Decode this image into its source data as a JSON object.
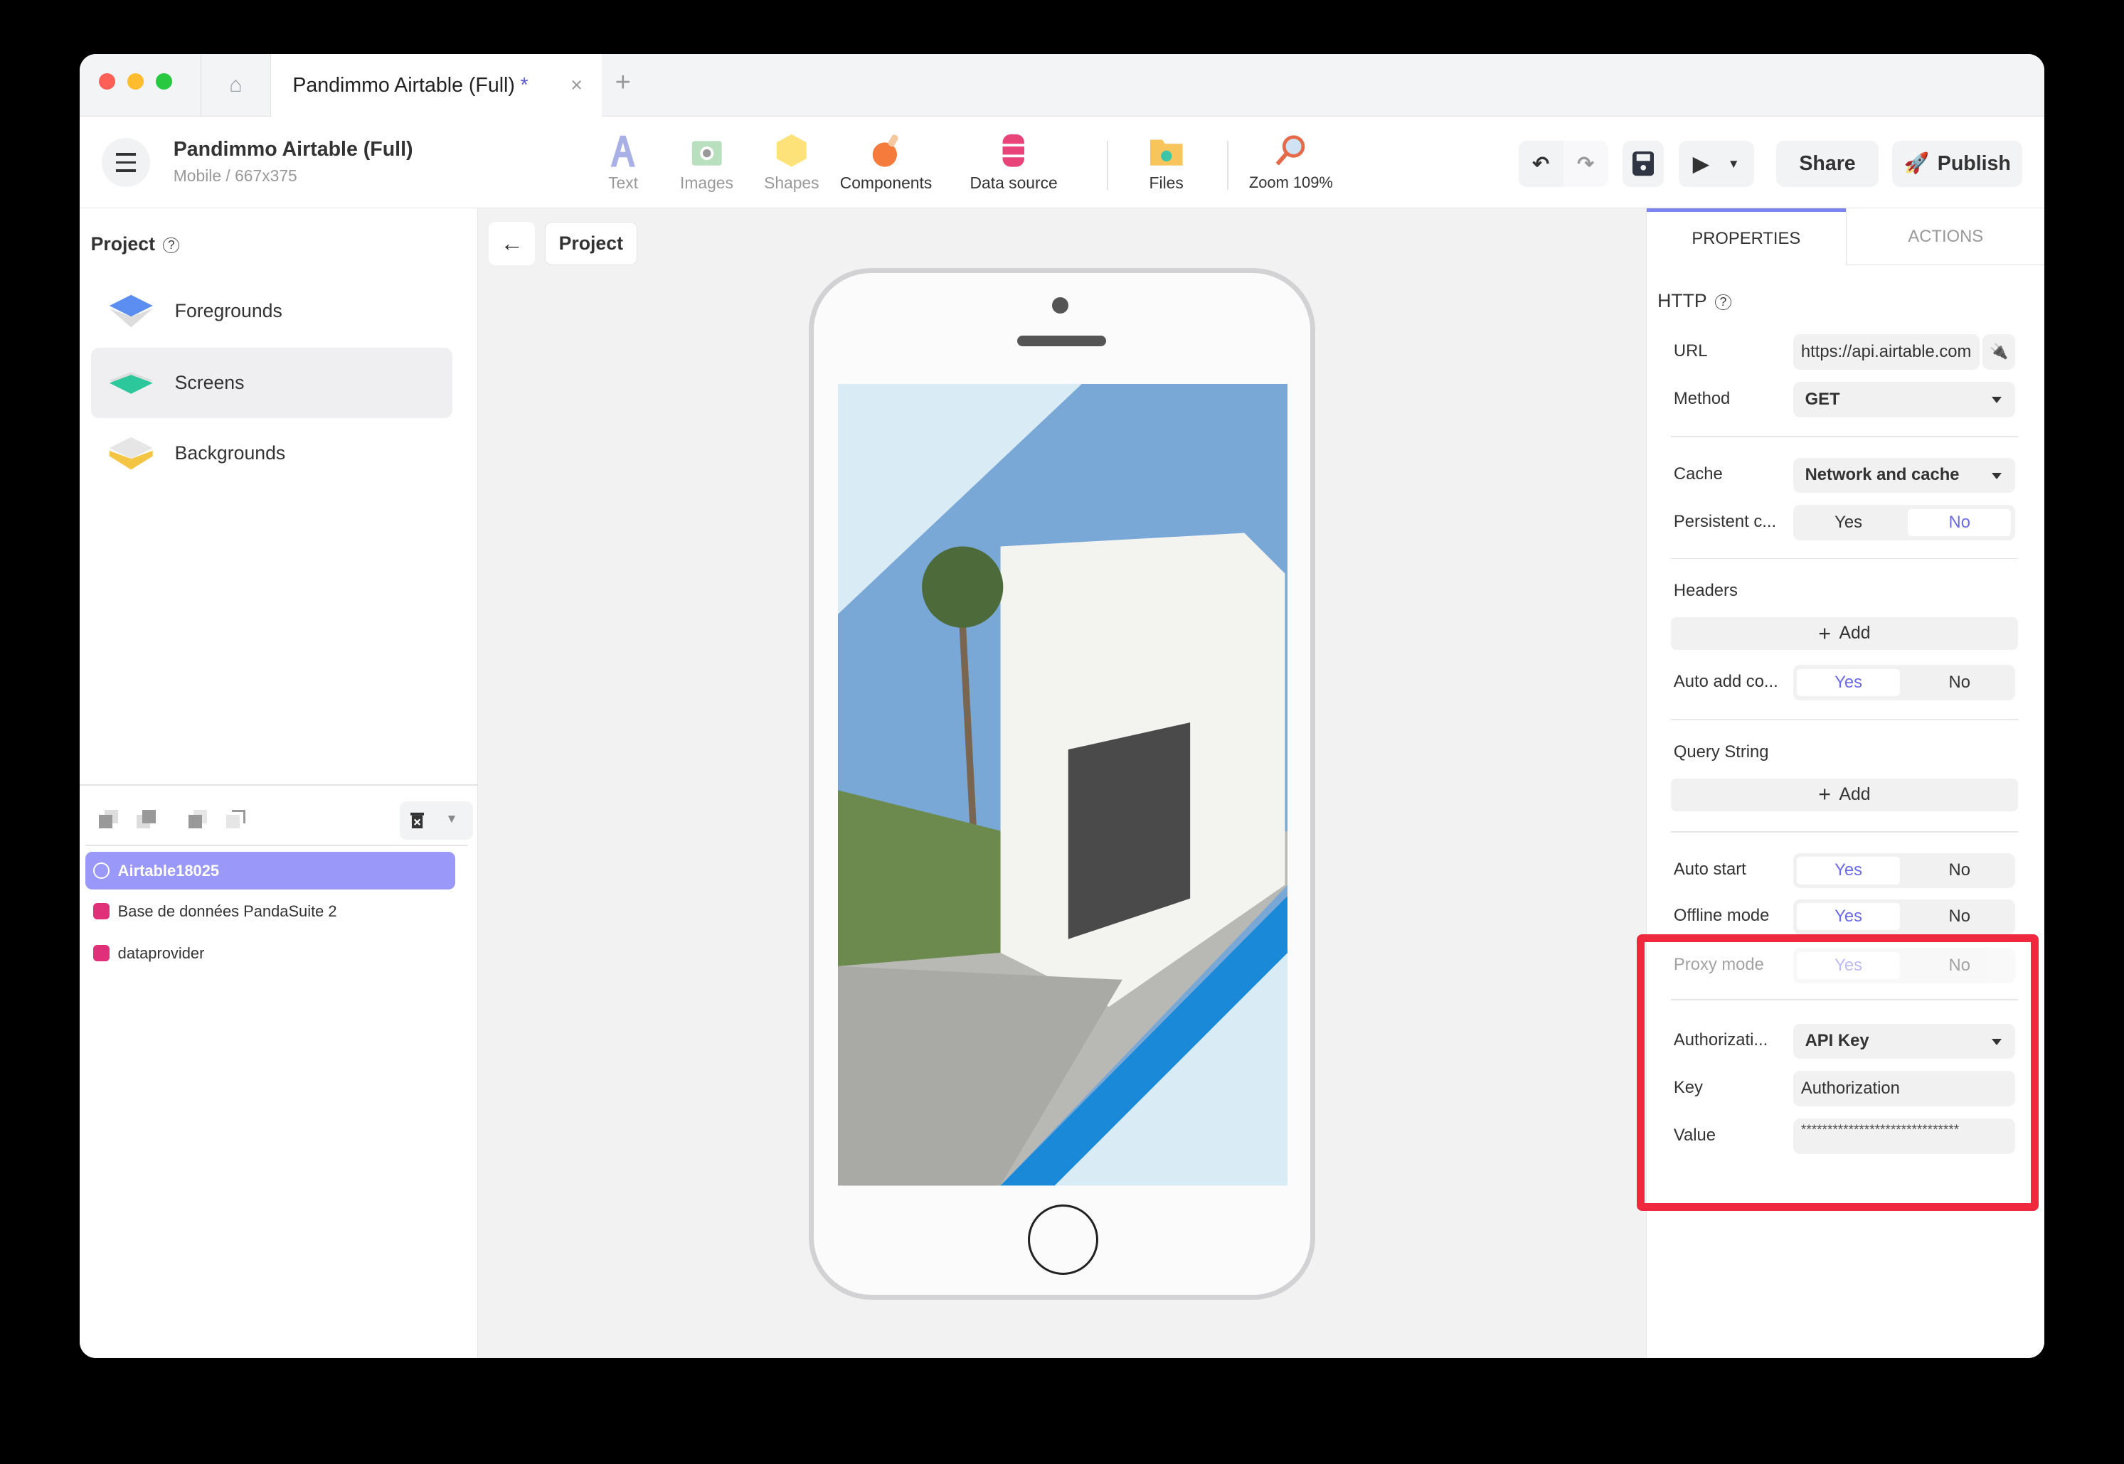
{
  "tab": {
    "title": "Pandimmo Airtable (Full)",
    "modified": "*",
    "close": "×",
    "new": "+"
  },
  "project": {
    "title": "Pandimmo Airtable (Full)",
    "subtitle": "Mobile / 667x375"
  },
  "tools": [
    {
      "label": "Text"
    },
    {
      "label": "Images"
    },
    {
      "label": "Shapes"
    },
    {
      "label": "Components"
    },
    {
      "label": "Data source"
    },
    {
      "label": "Files"
    },
    {
      "label": "Zoom 109%"
    }
  ],
  "actions": {
    "share": "Share",
    "publish": "Publish"
  },
  "left": {
    "title": "Project",
    "help": "?",
    "items": [
      {
        "label": "Foregrounds"
      },
      {
        "label": "Screens"
      },
      {
        "label": "Backgrounds"
      }
    ],
    "datasources": [
      {
        "label": "Airtable18025"
      },
      {
        "label": "Base de données PandaSuite 2"
      },
      {
        "label": "dataprovider"
      }
    ]
  },
  "canvas": {
    "back": "←",
    "breadcrumb": "Project"
  },
  "right": {
    "tabs": {
      "properties": "PROPERTIES",
      "actions": "ACTIONS"
    },
    "section": "HTTP",
    "help": "?",
    "url": {
      "label": "URL",
      "value": "https://api.airtable.com"
    },
    "method": {
      "label": "Method",
      "value": "GET"
    },
    "cache": {
      "label": "Cache",
      "value": "Network and cache"
    },
    "persistent": {
      "label": "Persistent c...",
      "yes": "Yes",
      "no": "No"
    },
    "headers": {
      "label": "Headers",
      "add": "Add"
    },
    "autoadd": {
      "label": "Auto add co...",
      "yes": "Yes",
      "no": "No"
    },
    "query": {
      "label": "Query String",
      "add": "Add"
    },
    "autostart": {
      "label": "Auto start",
      "yes": "Yes",
      "no": "No"
    },
    "offline": {
      "label": "Offline mode",
      "yes": "Yes",
      "no": "No"
    },
    "proxy": {
      "label": "Proxy mode",
      "yes": "Yes",
      "no": "No"
    },
    "auth": {
      "label": "Authorizati...",
      "value": "API Key"
    },
    "key": {
      "label": "Key",
      "value": "Authorization"
    },
    "val": {
      "label": "Value",
      "value": "******************************"
    }
  },
  "colors": {
    "accent": "#6b6bea",
    "selected": "#9a98f8",
    "highlight": "#f0283d"
  }
}
